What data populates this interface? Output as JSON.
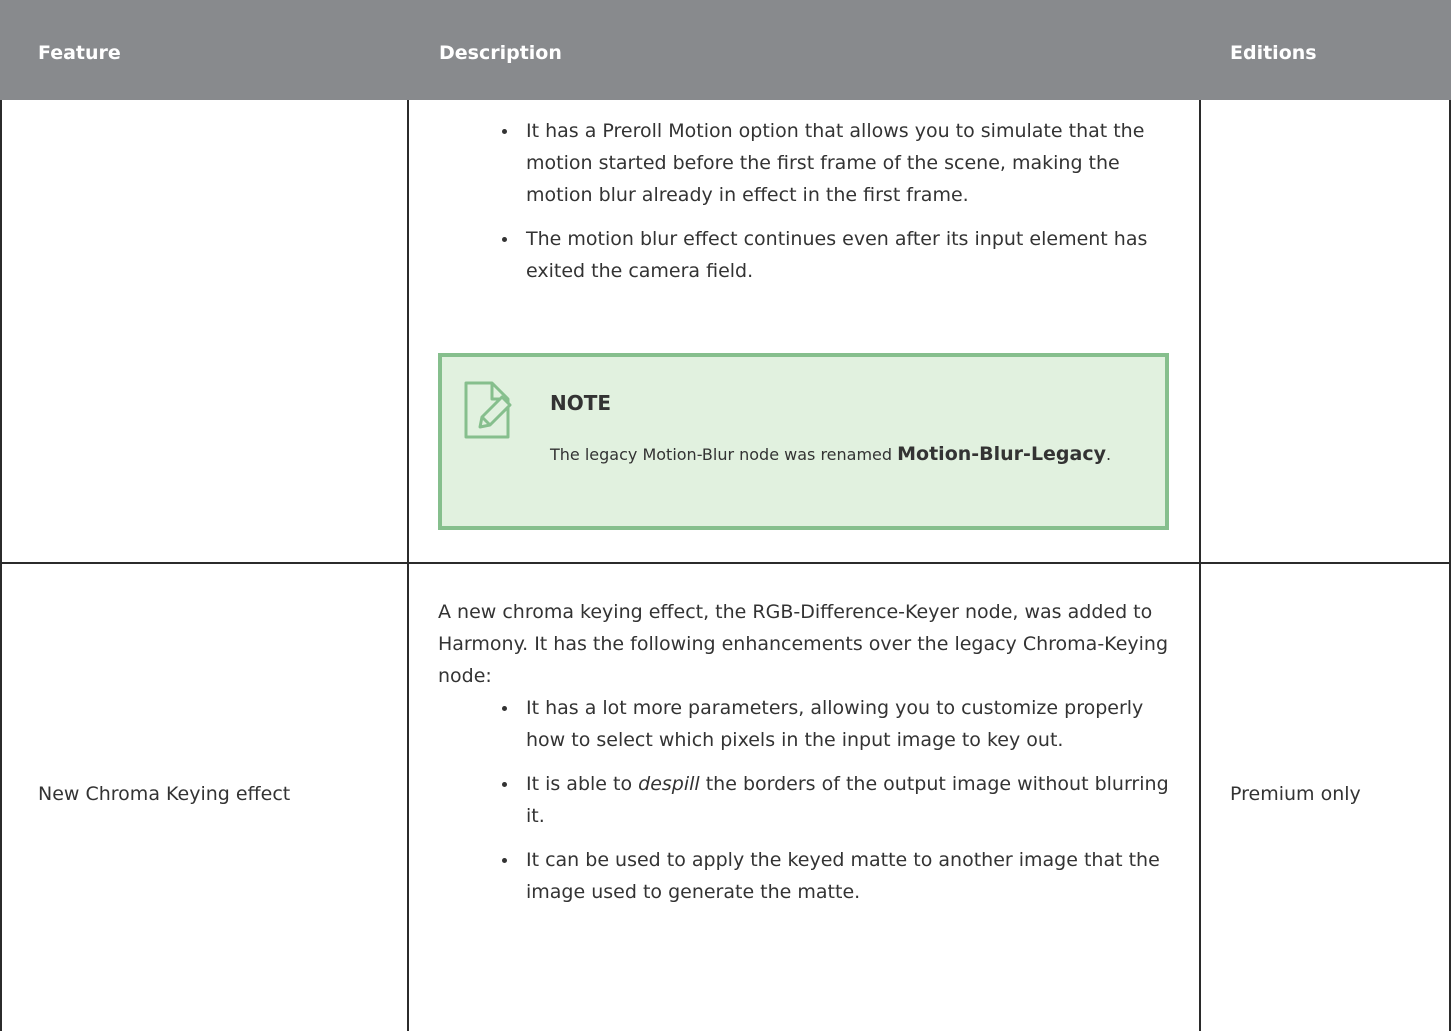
{
  "header": {
    "feature": "Feature",
    "description": "Description",
    "editions": "Editions"
  },
  "row1": {
    "feature": "",
    "bullets": [
      "It has a Preroll Motion option that allows you to simulate that the motion started before the first frame of the scene, making the motion blur already in effect in the first frame.",
      "The motion blur effect continues even after its input element has exited the camera field."
    ],
    "note": {
      "title": "NOTE",
      "text_before": "The legacy Motion-Blur node was renamed ",
      "bold": "Motion-Blur-Legacy",
      "text_after": "."
    },
    "editions": ""
  },
  "row2": {
    "feature": "New Chroma Keying effect",
    "intro": "A new chroma keying effect, the RGB-Difference-Keyer node, was added to Harmony. It has the following enhancements over the legacy Chroma-Keying node:",
    "bullet1": "It has a lot more parameters, allowing you to customize properly how to select which pixels in the input image to key out.",
    "bullet2_before": "It is able to ",
    "bullet2_italic": "despill",
    "bullet2_after": " the borders of the output image without blurring it.",
    "bullet3": "It can be used to apply the keyed matte to another image that the image used to generate the matte.",
    "editions": "Premium only"
  },
  "colors": {
    "header_bg": "#888a8d",
    "note_bg": "#e1f1df",
    "note_border": "#86bf8d",
    "note_icon": "#86bf8d"
  },
  "icons": {
    "note": "note-edit-icon"
  }
}
